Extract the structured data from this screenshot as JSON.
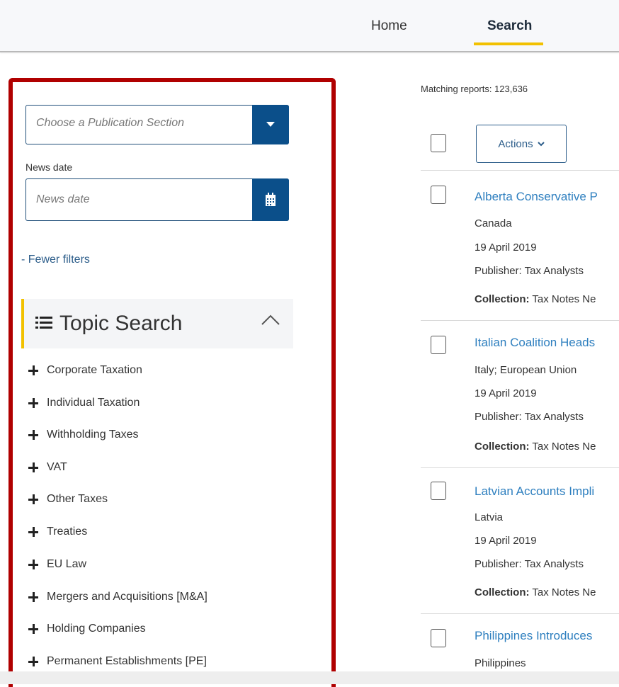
{
  "nav": {
    "home": "Home",
    "search": "Search"
  },
  "filters": {
    "section_placeholder": "Choose a Publication Section",
    "news_date_label": "News date",
    "news_date_placeholder": "News date",
    "fewer_filters": "- Fewer filters"
  },
  "topic_search": {
    "title": "Topic Search",
    "items": [
      "Corporate Taxation",
      "Individual Taxation",
      "Withholding Taxes",
      "VAT",
      "Other Taxes",
      "Treaties",
      "EU Law",
      "Mergers and Acquisitions [M&A]",
      "Holding Companies",
      "Permanent Establishments [PE]"
    ]
  },
  "results": {
    "matching": "Matching reports: 123,636",
    "actions_label": "Actions",
    "items": [
      {
        "title": "Alberta Conservative P",
        "country": "Canada",
        "date": "19 April 2019",
        "publisher": "Publisher: Tax Analysts",
        "collection_label": "Collection:",
        "collection_value": "Tax Notes Ne"
      },
      {
        "title": "Italian Coalition Heads",
        "country": "Italy; European Union",
        "date": "19 April 2019",
        "publisher": "Publisher: Tax Analysts",
        "collection_label": "Collection:",
        "collection_value": "Tax Notes Ne"
      },
      {
        "title": "Latvian Accounts Impli",
        "country": "Latvia",
        "date": "19 April 2019",
        "publisher": "Publisher: Tax Analysts",
        "collection_label": "Collection:",
        "collection_value": "Tax Notes Ne"
      },
      {
        "title": "Philippines Introduces",
        "country": "Philippines"
      }
    ]
  },
  "colors": {
    "accent_blue": "#0b4f8a",
    "link_blue": "#2e7fbf",
    "highlight_yellow": "#f2c100",
    "frame_red": "#b00000"
  },
  "icons": {
    "dropdown": "caret-down-icon",
    "calendar": "calendar-icon",
    "list": "list-icon",
    "collapse": "chevron-up-icon",
    "expand": "plus-icon"
  }
}
